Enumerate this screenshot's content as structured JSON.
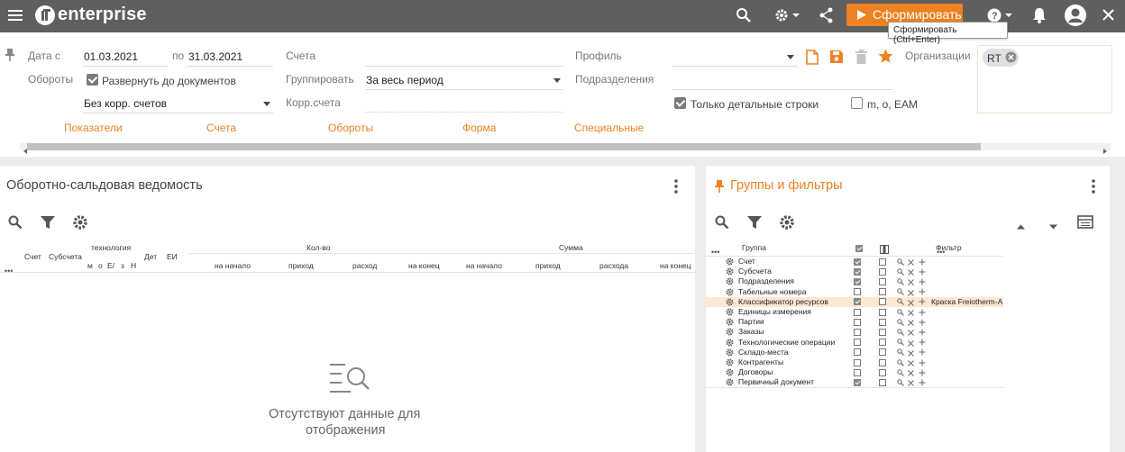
{
  "header": {
    "app_name": "enterprise",
    "form_button": "Сформировать",
    "tooltip": "Сформировать (Ctrl+Enter)",
    "icons": [
      "menu-icon",
      "logo-icon",
      "search-icon",
      "gear-icon",
      "share-icon",
      "play-icon",
      "help-icon",
      "bell-icon",
      "account-icon",
      "close-icon"
    ]
  },
  "filters": {
    "date_from_label": "Дата с",
    "date_from": "01.03.2021",
    "date_to_label": "по",
    "date_to": "31.03.2021",
    "accounts_label": "Счета",
    "profile_label": "Профиль",
    "organizations_label": "Организации",
    "organization_chip": "RT",
    "turnovers_label": "Обороты",
    "expand_docs_label": "Развернуть до документов",
    "expand_docs_checked": true,
    "group_label": "Группировать",
    "group_value": "За весь период",
    "departments_label": "Подразделения",
    "corr_select": "Без корр. счетов",
    "corr_accounts_label": "Корр.счета",
    "only_detail_label": "Только детальные строки",
    "only_detail_checked": true,
    "m_o_eam_label": "m, o, EAM",
    "m_o_eam_checked": false,
    "tabs": [
      "Показатели",
      "Счета",
      "Обороты",
      "Форма",
      "Специальные"
    ]
  },
  "left_panel": {
    "title": "Оборотно-сальдовая ведомость",
    "columns": {
      "schet": "Счет",
      "subschet": "Субсчета",
      "tech": "технология",
      "tech_sub": [
        "м",
        "о",
        "Е/",
        "з",
        "Н"
      ],
      "det": "Дет",
      "ei": "ЕИ",
      "qty": "Кол-во",
      "sum": "Сумма",
      "qty_sub": [
        "на начало",
        "приход",
        "расход",
        "на конец"
      ],
      "sum_sub": [
        "на начало",
        "приход",
        "расхода",
        "на конец"
      ]
    },
    "empty_text_line1": "Отсутствуют данные для",
    "empty_text_line2": "отображения"
  },
  "right_panel": {
    "title": "Группы и фильтры",
    "col_group": "Группа",
    "col_filter": "Фильтр",
    "rows": [
      {
        "name": "Счет",
        "c1": true,
        "c2": false,
        "filter": ""
      },
      {
        "name": "Субсчета",
        "c1": true,
        "c2": false,
        "filter": ""
      },
      {
        "name": "Подразделения",
        "c1": true,
        "c2": false,
        "filter": ""
      },
      {
        "name": "Табельные номера",
        "c1": false,
        "c2": false,
        "filter": ""
      },
      {
        "name": "Классификатор ресурсов",
        "c1": true,
        "c2": false,
        "filter": "Краска Freiotherm-A",
        "highlight": true
      },
      {
        "name": "Единицы измерения",
        "c1": false,
        "c2": false,
        "filter": ""
      },
      {
        "name": "Партии",
        "c1": false,
        "c2": false,
        "filter": ""
      },
      {
        "name": "Заказы",
        "c1": false,
        "c2": false,
        "filter": ""
      },
      {
        "name": "Технологические операции",
        "c1": false,
        "c2": false,
        "filter": ""
      },
      {
        "name": "Складо-места",
        "c1": false,
        "c2": false,
        "filter": ""
      },
      {
        "name": "Контрагенты",
        "c1": false,
        "c2": false,
        "filter": ""
      },
      {
        "name": "Договоры",
        "c1": false,
        "c2": false,
        "filter": ""
      },
      {
        "name": "Первичный документ",
        "c1": true,
        "c2": false,
        "filter": ""
      }
    ]
  },
  "colors": {
    "topbar": "#5f5f5f",
    "accent": "#ee8122",
    "highlight_row": "#fde8d2"
  }
}
